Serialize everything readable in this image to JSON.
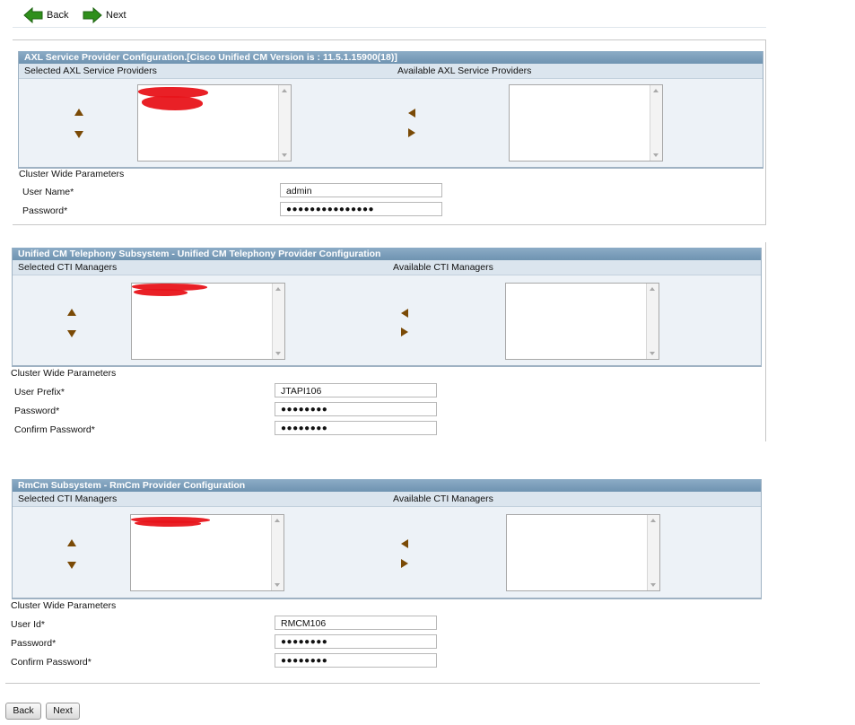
{
  "toolbar": {
    "back_label": "Back",
    "next_label": "Next"
  },
  "colors": {
    "header_bg": "#7e9fbc",
    "subheader_bg": "#dbe5ee",
    "arrow": "#7a4a06",
    "nav_green": "#2f8f1b"
  },
  "axl": {
    "title": "AXL Service Provider Configuration.[Cisco Unified CM Version is : 11.5.1.15900(18)]",
    "selected_label": "Selected AXL Service Providers",
    "available_label": "Available AXL Service Providers",
    "cluster_label": "Cluster Wide Parameters",
    "user_name_label": "User Name*",
    "user_name_value": "admin",
    "password_label": "Password*",
    "password_value": "●●●●●●●●●●●●●●●"
  },
  "telephony": {
    "title": "Unified CM Telephony Subsystem - Unified CM Telephony Provider Configuration",
    "selected_label": "Selected CTI Managers",
    "available_label": "Available CTI Managers",
    "cluster_label": "Cluster Wide Parameters",
    "user_prefix_label": "User Prefix*",
    "user_prefix_value": "JTAPI106",
    "password_label": "Password*",
    "password_value": "●●●●●●●●",
    "confirm_label": "Confirm Password*",
    "confirm_value": "●●●●●●●●"
  },
  "rmcm": {
    "title": "RmCm Subsystem - RmCm Provider Configuration",
    "selected_label": "Selected CTI Managers",
    "available_label": "Available CTI Managers",
    "cluster_label": "Cluster Wide Parameters",
    "user_id_label": "User Id*",
    "user_id_value": "RMCM106",
    "password_label": "Password*",
    "password_value": "●●●●●●●●",
    "confirm_label": "Confirm Password*",
    "confirm_value": "●●●●●●●●"
  },
  "footer": {
    "back_label": "Back",
    "next_label": "Next"
  }
}
